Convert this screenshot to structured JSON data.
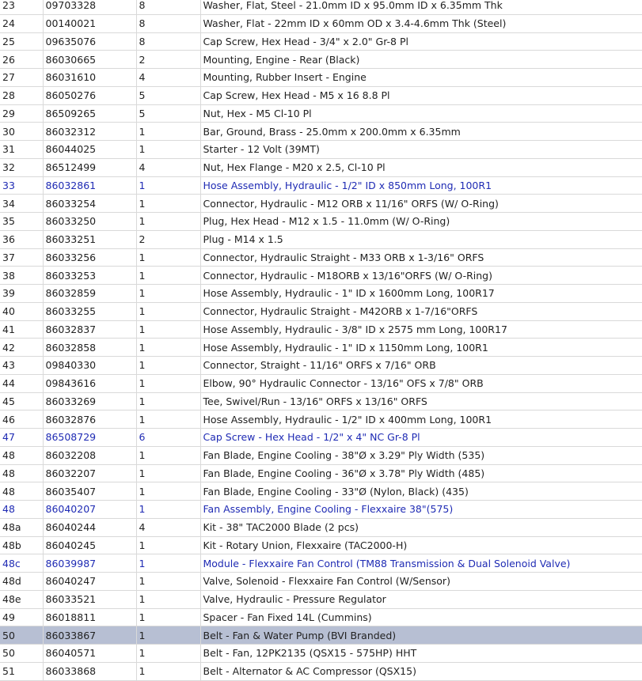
{
  "parts_table": {
    "rows": [
      {
        "item": "23",
        "part": "09703328",
        "qty": "8",
        "desc": "Washer, Flat, Steel - 21.0mm ID x 95.0mm ID x 6.35mm Thk",
        "style": "normal"
      },
      {
        "item": "24",
        "part": "00140021",
        "qty": "8",
        "desc": "Washer, Flat - 22mm ID x 60mm OD x 3.4-4.6mm Thk (Steel)",
        "style": "normal"
      },
      {
        "item": "25",
        "part": "09635076",
        "qty": "8",
        "desc": "Cap Screw, Hex Head - 3/4\" x 2.0\" Gr-8 Pl",
        "style": "normal"
      },
      {
        "item": "26",
        "part": "86030665",
        "qty": "2",
        "desc": "Mounting, Engine - Rear (Black)",
        "style": "normal"
      },
      {
        "item": "27",
        "part": "86031610",
        "qty": "4",
        "desc": "Mounting, Rubber Insert - Engine",
        "style": "normal"
      },
      {
        "item": "28",
        "part": "86050276",
        "qty": "5",
        "desc": "Cap Screw, Hex Head - M5 x 16 8.8 Pl",
        "style": "normal"
      },
      {
        "item": "29",
        "part": "86509265",
        "qty": "5",
        "desc": "Nut, Hex - M5 Cl-10 Pl",
        "style": "normal"
      },
      {
        "item": "30",
        "part": "86032312",
        "qty": "1",
        "desc": "Bar, Ground, Brass - 25.0mm x 200.0mm x 6.35mm",
        "style": "normal"
      },
      {
        "item": "31",
        "part": "86044025",
        "qty": "1",
        "desc": "Starter - 12 Volt (39MT)",
        "style": "normal"
      },
      {
        "item": "32",
        "part": "86512499",
        "qty": "4",
        "desc": "Nut, Hex Flange - M20 x 2.5, Cl-10 Pl",
        "style": "normal"
      },
      {
        "item": "33",
        "part": "86032861",
        "qty": "1",
        "desc": "Hose Assembly, Hydraulic - 1/2\" ID x 850mm Long, 100R1",
        "style": "link"
      },
      {
        "item": "34",
        "part": "86033254",
        "qty": "1",
        "desc": "Connector, Hydraulic - M12 ORB x 11/16\" ORFS (W/ O-Ring)",
        "style": "normal"
      },
      {
        "item": "35",
        "part": "86033250",
        "qty": "1",
        "desc": "Plug, Hex Head - M12 x 1.5 - 11.0mm (W/ O-Ring)",
        "style": "normal"
      },
      {
        "item": "36",
        "part": "86033251",
        "qty": "2",
        "desc": "Plug - M14 x 1.5",
        "style": "normal"
      },
      {
        "item": "37",
        "part": "86033256",
        "qty": "1",
        "desc": "Connector, Hydraulic Straight - M33 ORB x 1-3/16\" ORFS",
        "style": "normal"
      },
      {
        "item": "38",
        "part": "86033253",
        "qty": "1",
        "desc": "Connector, Hydraulic - M18ORB x 13/16\"ORFS (W/ O-Ring)",
        "style": "normal"
      },
      {
        "item": "39",
        "part": "86032859",
        "qty": "1",
        "desc": "Hose Assembly, Hydraulic - 1\" ID x 1600mm Long, 100R17",
        "style": "normal"
      },
      {
        "item": "40",
        "part": "86033255",
        "qty": "1",
        "desc": "Connector, Hydraulic Straight - M42ORB x 1-7/16\"ORFS",
        "style": "normal"
      },
      {
        "item": "41",
        "part": "86032837",
        "qty": "1",
        "desc": "Hose Assembly, Hydraulic - 3/8\" ID x 2575 mm Long, 100R17",
        "style": "normal"
      },
      {
        "item": "42",
        "part": "86032858",
        "qty": "1",
        "desc": "Hose Assembly, Hydraulic - 1\" ID x 1150mm Long, 100R1",
        "style": "normal"
      },
      {
        "item": "43",
        "part": "09840330",
        "qty": "1",
        "desc": "Connector, Straight - 11/16\" ORFS x 7/16\" ORB",
        "style": "normal"
      },
      {
        "item": "44",
        "part": "09843616",
        "qty": "1",
        "desc": "Elbow, 90° Hydraulic Connector - 13/16\" OFS x 7/8\" ORB",
        "style": "normal"
      },
      {
        "item": "45",
        "part": "86033269",
        "qty": "1",
        "desc": "Tee, Swivel/Run - 13/16\" ORFS x 13/16\" ORFS",
        "style": "normal"
      },
      {
        "item": "46",
        "part": "86032876",
        "qty": "1",
        "desc": "Hose Assembly, Hydraulic - 1/2\" ID x 400mm Long, 100R1",
        "style": "normal"
      },
      {
        "item": "47",
        "part": "86508729",
        "qty": "6",
        "desc": "Cap Screw - Hex Head - 1/2\" x 4\" NC Gr-8 Pl",
        "style": "link"
      },
      {
        "item": "48",
        "part": "86032208",
        "qty": "1",
        "desc": "Fan Blade, Engine Cooling - 38\"Ø x 3.29\" Ply Width (535)",
        "style": "normal"
      },
      {
        "item": "48",
        "part": "86032207",
        "qty": "1",
        "desc": "Fan Blade, Engine Cooling - 36\"Ø x 3.78\" Ply Width (485)",
        "style": "normal"
      },
      {
        "item": "48",
        "part": "86035407",
        "qty": "1",
        "desc": "Fan Blade, Engine Cooling - 33\"Ø (Nylon, Black) (435)",
        "style": "normal"
      },
      {
        "item": "48",
        "part": "86040207",
        "qty": "1",
        "desc": "Fan Assembly, Engine Cooling - Flexxaire 38\"(575)",
        "style": "link"
      },
      {
        "item": "48a",
        "part": "86040244",
        "qty": "4",
        "desc": "Kit - 38\" TAC2000 Blade (2 pcs)",
        "style": "normal"
      },
      {
        "item": "48b",
        "part": "86040245",
        "qty": "1",
        "desc": "Kit - Rotary Union, Flexxaire (TAC2000-H)",
        "style": "normal"
      },
      {
        "item": "48c",
        "part": "86039987",
        "qty": "1",
        "desc": "Module - Flexxaire Fan Control (TM88 Transmission & Dual Solenoid Valve)",
        "style": "link"
      },
      {
        "item": "48d",
        "part": "86040247",
        "qty": "1",
        "desc": "Valve, Solenoid - Flexxaire Fan Control (W/Sensor)",
        "style": "normal"
      },
      {
        "item": "48e",
        "part": "86033521",
        "qty": "1",
        "desc": "Valve, Hydraulic - Pressure Regulator",
        "style": "normal"
      },
      {
        "item": "49",
        "part": "86018811",
        "qty": "1",
        "desc": "Spacer - Fan Fixed 14L (Cummins)",
        "style": "normal"
      },
      {
        "item": "50",
        "part": "86033867",
        "qty": "1",
        "desc": "Belt - Fan & Water Pump (BVI Branded)",
        "style": "selected"
      },
      {
        "item": "50",
        "part": "86040571",
        "qty": "1",
        "desc": "Belt - Fan, 12PK2135 (QSX15 - 575HP) HHT",
        "style": "normal"
      },
      {
        "item": "51",
        "part": "86033868",
        "qty": "1",
        "desc": "Belt - Alternator & AC Compressor (QSX15)",
        "style": "normal"
      }
    ],
    "colors": {
      "link": "#1f2bb4",
      "selected_row": "#b7bfd3",
      "grid": "#d9d9d9"
    }
  }
}
